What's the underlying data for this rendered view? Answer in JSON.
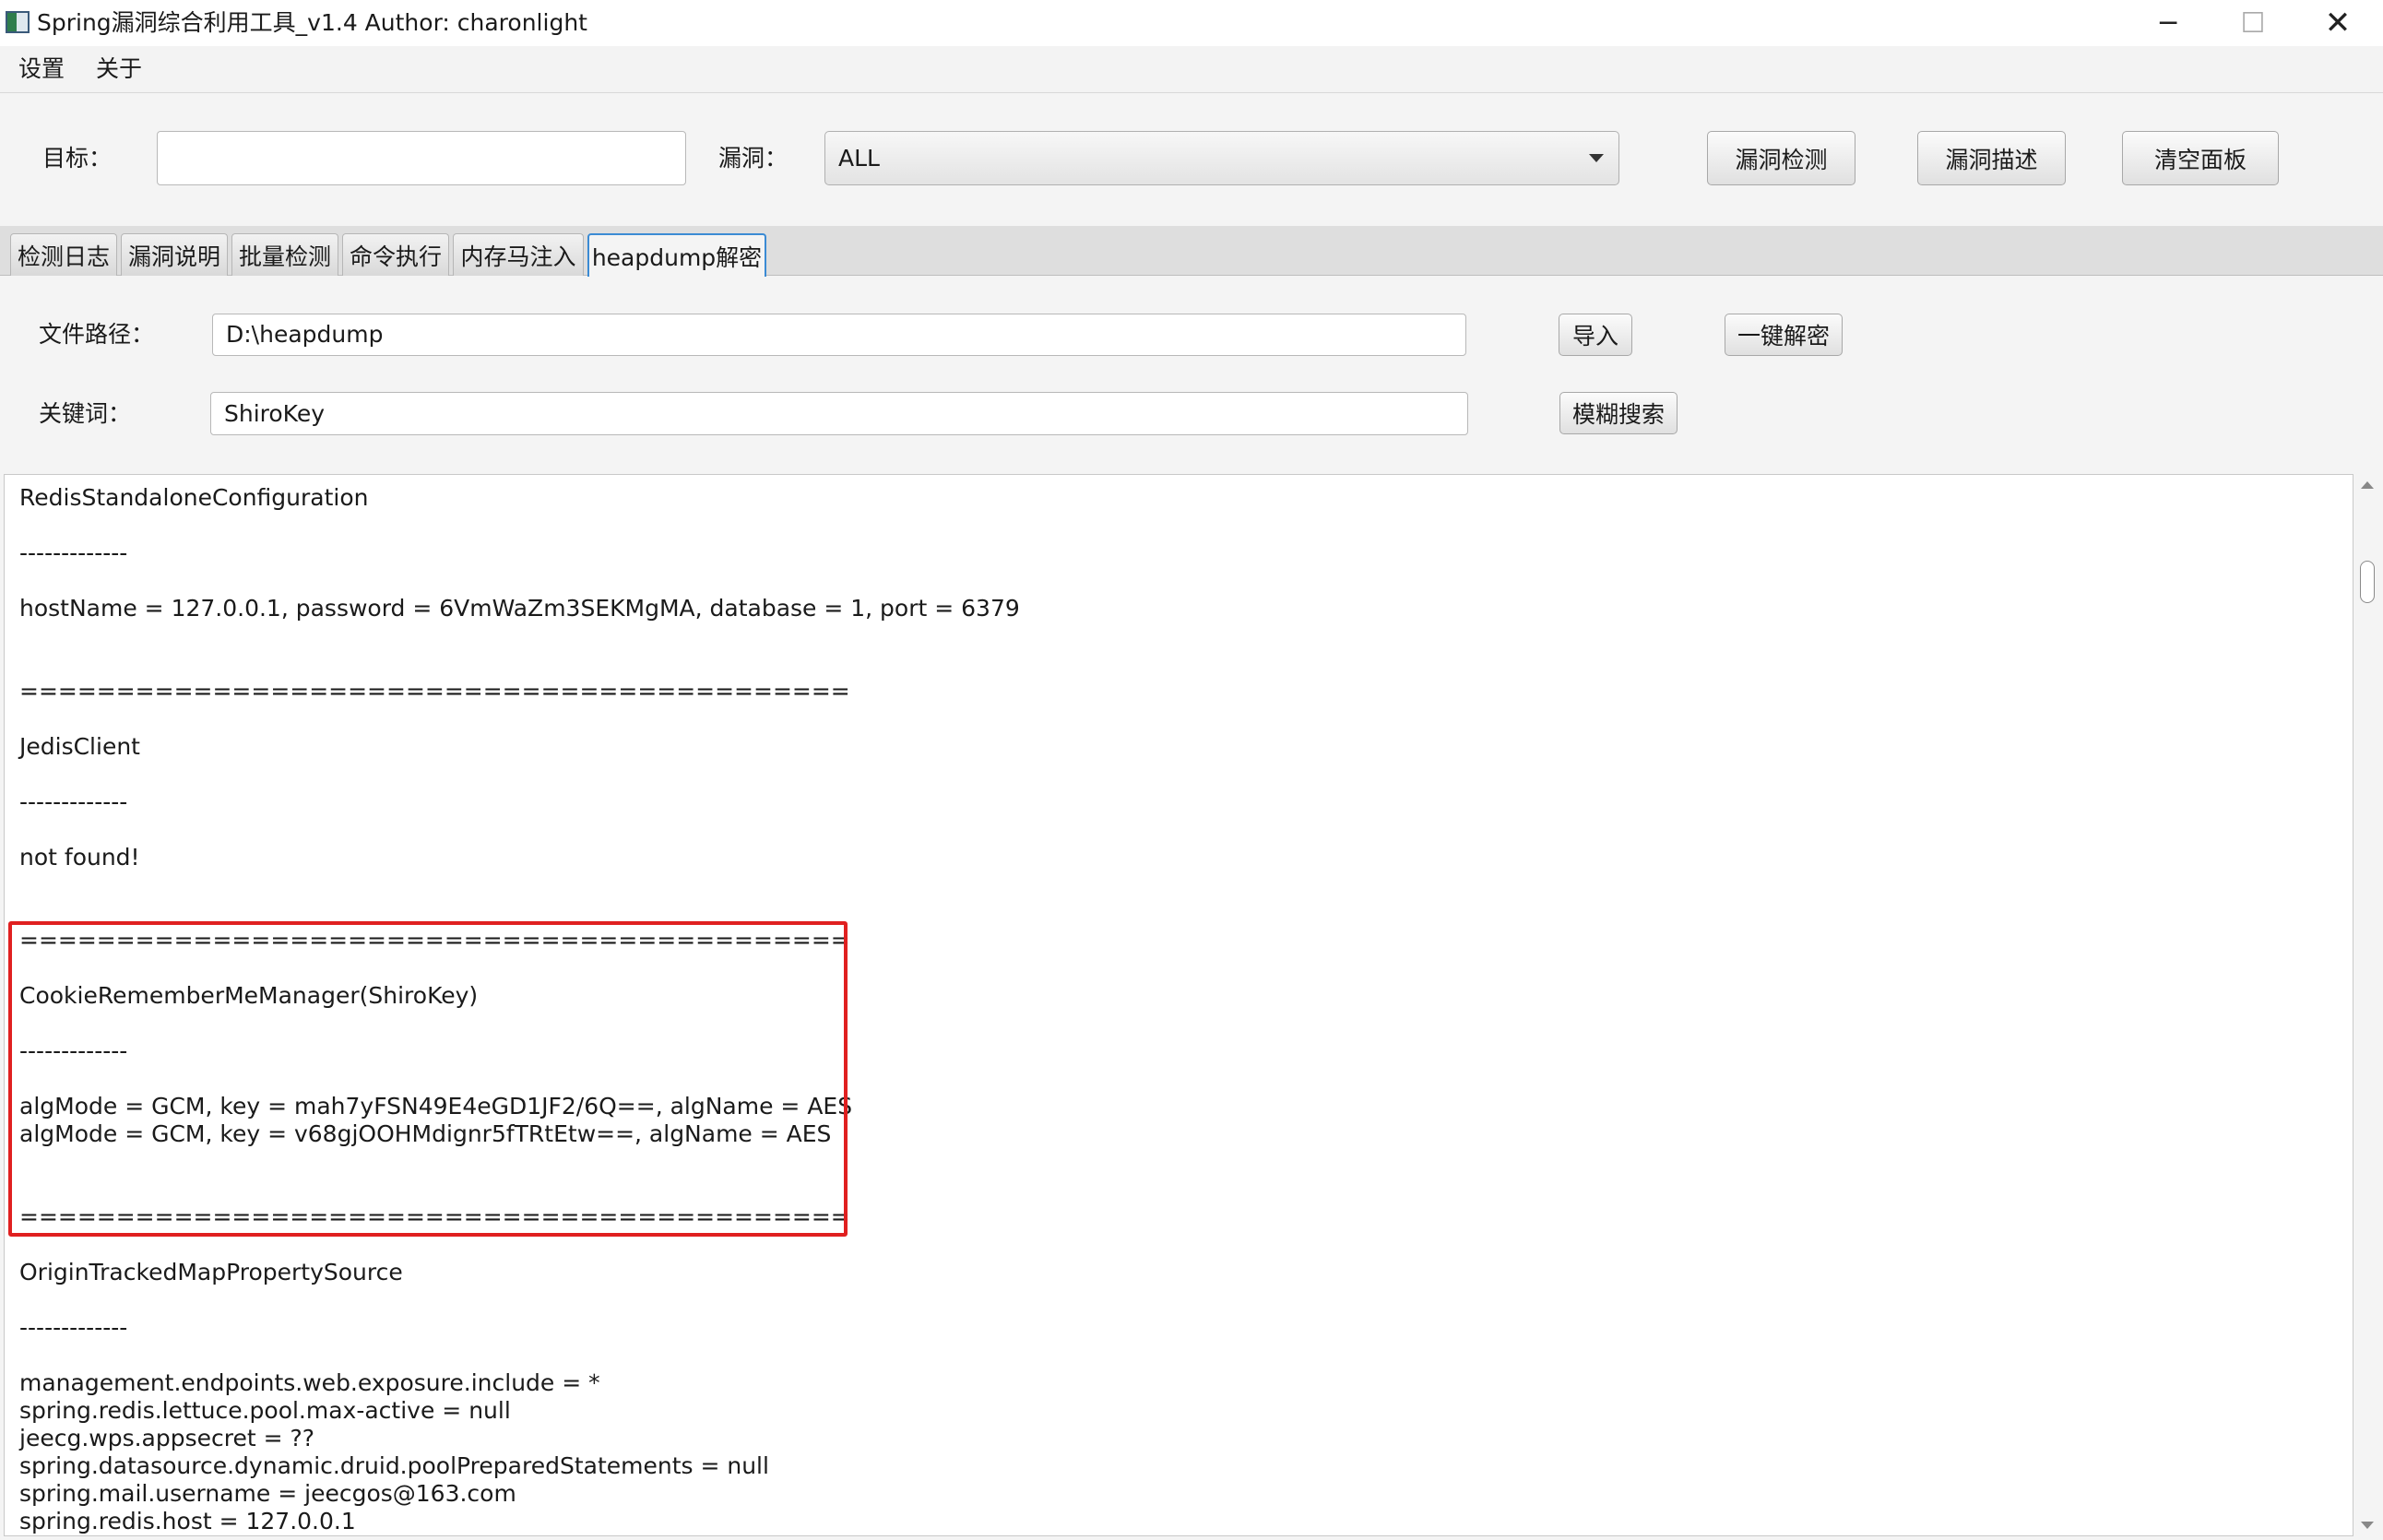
{
  "window": {
    "title": "Spring漏洞综合利用工具_v1.4 Author: charonlight",
    "minimize": "─",
    "maximize": "☐",
    "close": "✕"
  },
  "menu": [
    "设置",
    "关于"
  ],
  "toolbar": {
    "target_label": "目标：",
    "target_value": "",
    "vuln_label": "漏洞：",
    "vuln_selected": "ALL",
    "buttons": [
      "漏洞检测",
      "漏洞描述",
      "清空面板"
    ]
  },
  "tabs": [
    "检测日志",
    "漏洞说明",
    "批量检测",
    "命令执行",
    "内存马注入",
    "heapdump解密"
  ],
  "active_tab": "heapdump解密",
  "heapdump": {
    "path_label": "文件路径：",
    "path_value": "D:\\heapdump",
    "import_button": "导入",
    "decrypt_button": "一键解密",
    "keyword_label": "关键词：",
    "keyword_value": "ShiroKey",
    "search_button": "模糊搜索"
  },
  "output_lines": [
    "RedisStandaloneConfiguration",
    "-------------",
    "hostName = 127.0.0.1, password = 6VmWaZm3SEKMgMA, database = 1, port = 6379",
    "===========================================",
    "JedisClient",
    "-------------",
    "not found!",
    "===========================================",
    "CookieRememberMeManager(ShiroKey)",
    "-------------",
    "algMode = GCM, key = mah7yFSN49E4eGD1JF2/6Q==, algName = AES",
    "algMode = GCM, key = v68gjOOHMdignr5fTRtEtw==, algName = AES",
    "===========================================",
    "OriginTrackedMapPropertySource",
    "-------------",
    "management.endpoints.web.exposure.include = *",
    "spring.redis.lettuce.pool.max-active = null",
    "jeecg.wps.appsecret = ??",
    "spring.datasource.dynamic.druid.poolPreparedStatements = null",
    "spring.mail.username = jeecgos@163.com",
    "spring.redis.host = 127.0.0.1"
  ]
}
